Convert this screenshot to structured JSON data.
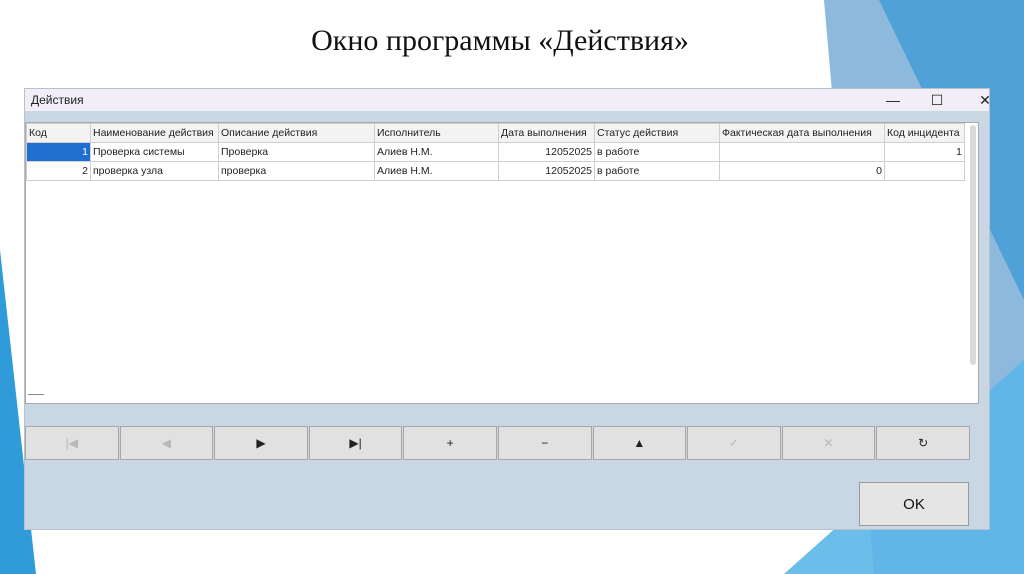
{
  "slide": {
    "title": "Окно программы «Действия»"
  },
  "window": {
    "title": "Действия",
    "controls": {
      "minimize": "—",
      "maximize": "☐",
      "close": "✕"
    }
  },
  "table": {
    "columns": [
      "Код",
      "Наименование действия",
      "Описание действия",
      "Исполнитель",
      "Дата выполнения",
      "Статус действия",
      "Фактическая дата выполнения",
      "Код инцидента"
    ],
    "rows": [
      [
        "1",
        "Проверка системы",
        "Проверка",
        "Алиев Н.М.",
        "12052025",
        "в работе",
        "",
        "1"
      ],
      [
        "2",
        "проверка узла",
        "проверка",
        "Алиев Н.М.",
        "12052025",
        "в работе",
        "0",
        ""
      ]
    ]
  },
  "navigator": {
    "buttons": [
      {
        "icon": "first-record-icon",
        "glyph": "|◀",
        "enabled": false
      },
      {
        "icon": "prior-record-icon",
        "glyph": "◀",
        "enabled": false
      },
      {
        "icon": "next-record-icon",
        "glyph": "▶",
        "enabled": true
      },
      {
        "icon": "last-record-icon",
        "glyph": "▶|",
        "enabled": true
      },
      {
        "icon": "insert-record-icon",
        "glyph": "+",
        "enabled": true
      },
      {
        "icon": "delete-record-icon",
        "glyph": "−",
        "enabled": true
      },
      {
        "icon": "edit-record-icon",
        "glyph": "▲",
        "enabled": true
      },
      {
        "icon": "post-record-icon",
        "glyph": "✓",
        "enabled": false
      },
      {
        "icon": "cancel-edit-icon",
        "glyph": "✕",
        "enabled": false
      },
      {
        "icon": "refresh-icon",
        "glyph": "↻",
        "enabled": true
      }
    ]
  },
  "ok_button": {
    "label": "OK"
  }
}
